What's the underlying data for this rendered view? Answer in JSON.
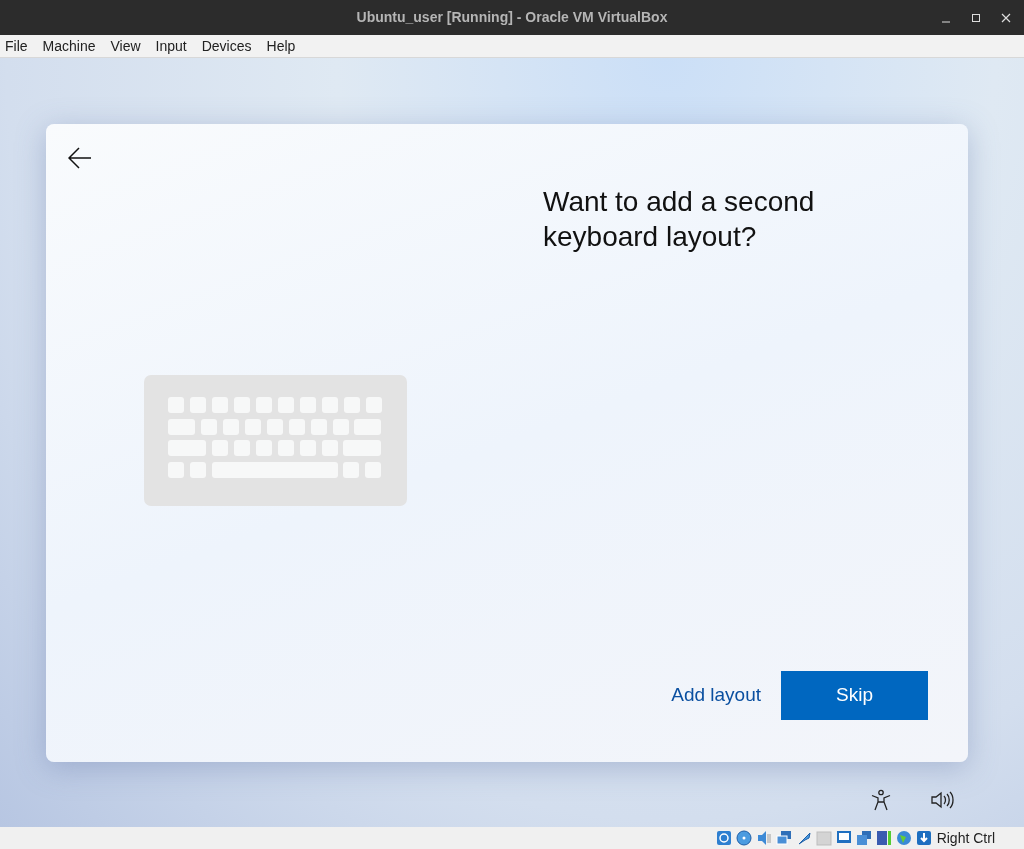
{
  "window": {
    "title": "Ubuntu_user [Running] - Oracle VM VirtualBox"
  },
  "menu": [
    "File",
    "Machine",
    "View",
    "Input",
    "Devices",
    "Help"
  ],
  "setup": {
    "heading": "Want to add a second keyboard layout?",
    "secondary_button": "Add layout",
    "primary_button": "Skip"
  },
  "status_bar": {
    "host_key": "Right Ctrl"
  }
}
